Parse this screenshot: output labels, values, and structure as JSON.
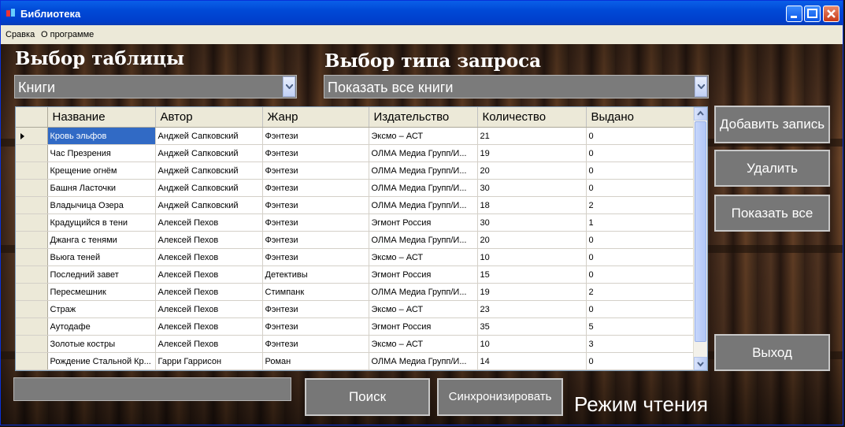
{
  "window": {
    "title": "Библиотека"
  },
  "menu": {
    "items": [
      "Сравка",
      "О программе"
    ]
  },
  "labels": {
    "table_select": "Выбор таблицы",
    "query_select": "Выбор типа запроса",
    "mode": "Режим чтения"
  },
  "combos": {
    "table": "Книги",
    "query": "Показать все книги"
  },
  "grid": {
    "columns": [
      "Название",
      "Автор",
      "Жанр",
      "Издательство",
      "Количество",
      "Выдано"
    ],
    "rows": [
      [
        "Кровь эльфов",
        "Анджей Сапковский",
        "Фэнтези",
        "Эксмо – АСТ",
        "21",
        "0"
      ],
      [
        "Час Презрения",
        "Анджей Сапковский",
        "Фэнтези",
        "ОЛМА Медиа Групп/И...",
        "19",
        "0"
      ],
      [
        "Крещение огнём",
        "Анджей Сапковский",
        "Фэнтези",
        "ОЛМА Медиа Групп/И...",
        "20",
        "0"
      ],
      [
        "Башня Ласточки",
        "Анджей Сапковский",
        "Фэнтези",
        "ОЛМА Медиа Групп/И...",
        "30",
        "0"
      ],
      [
        "Владычица Озера",
        "Анджей Сапковский",
        "Фэнтези",
        "ОЛМА Медиа Групп/И...",
        "18",
        "2"
      ],
      [
        "Крадущийся в тени",
        "Алексей Пехов",
        "Фэнтези",
        "Эгмонт Россия",
        "30",
        "1"
      ],
      [
        "Джанга с тенями",
        "Алексей Пехов",
        "Фэнтези",
        "ОЛМА Медиа Групп/И...",
        "20",
        "0"
      ],
      [
        "Вьюга теней",
        "Алексей Пехов",
        "Фэнтези",
        "Эксмо – АСТ",
        "10",
        "0"
      ],
      [
        "Последний завет",
        "Алексей Пехов",
        "Детективы",
        "Эгмонт Россия",
        "15",
        "0"
      ],
      [
        "Пересмешник",
        "Алексей Пехов",
        "Стимпанк",
        "ОЛМА Медиа Групп/И...",
        "19",
        "2"
      ],
      [
        "Страж",
        "Алексей Пехов",
        "Фэнтези",
        "Эксмо – АСТ",
        "23",
        "0"
      ],
      [
        "Аутодафе",
        "Алексей Пехов",
        "Фэнтези",
        "Эгмонт Россия",
        "35",
        "5"
      ],
      [
        "Золотые костры",
        "Алексей Пехов",
        "Фэнтези",
        "Эксмо – АСТ",
        "10",
        "3"
      ],
      [
        "Рождение Стальной Кр...",
        "Гарри Гаррисон",
        "Роман",
        "ОЛМА Медиа Групп/И...",
        "14",
        "0"
      ]
    ]
  },
  "buttons": {
    "add": "Добавить запись",
    "delete": "Удалить",
    "show_all": "Показать все",
    "exit": "Выход",
    "search": "Поиск",
    "sync": "Синхронизировать"
  },
  "search": {
    "value": ""
  },
  "icons": {
    "app": "app-icon",
    "minimize": "minimize-icon",
    "maximize": "maximize-icon",
    "close": "close-icon",
    "dropdown": "chevron-down-icon",
    "row_pointer": "row-pointer-icon"
  },
  "colors": {
    "titlebar": "#0049d6",
    "selection": "#316ac5",
    "button": "#777777"
  }
}
